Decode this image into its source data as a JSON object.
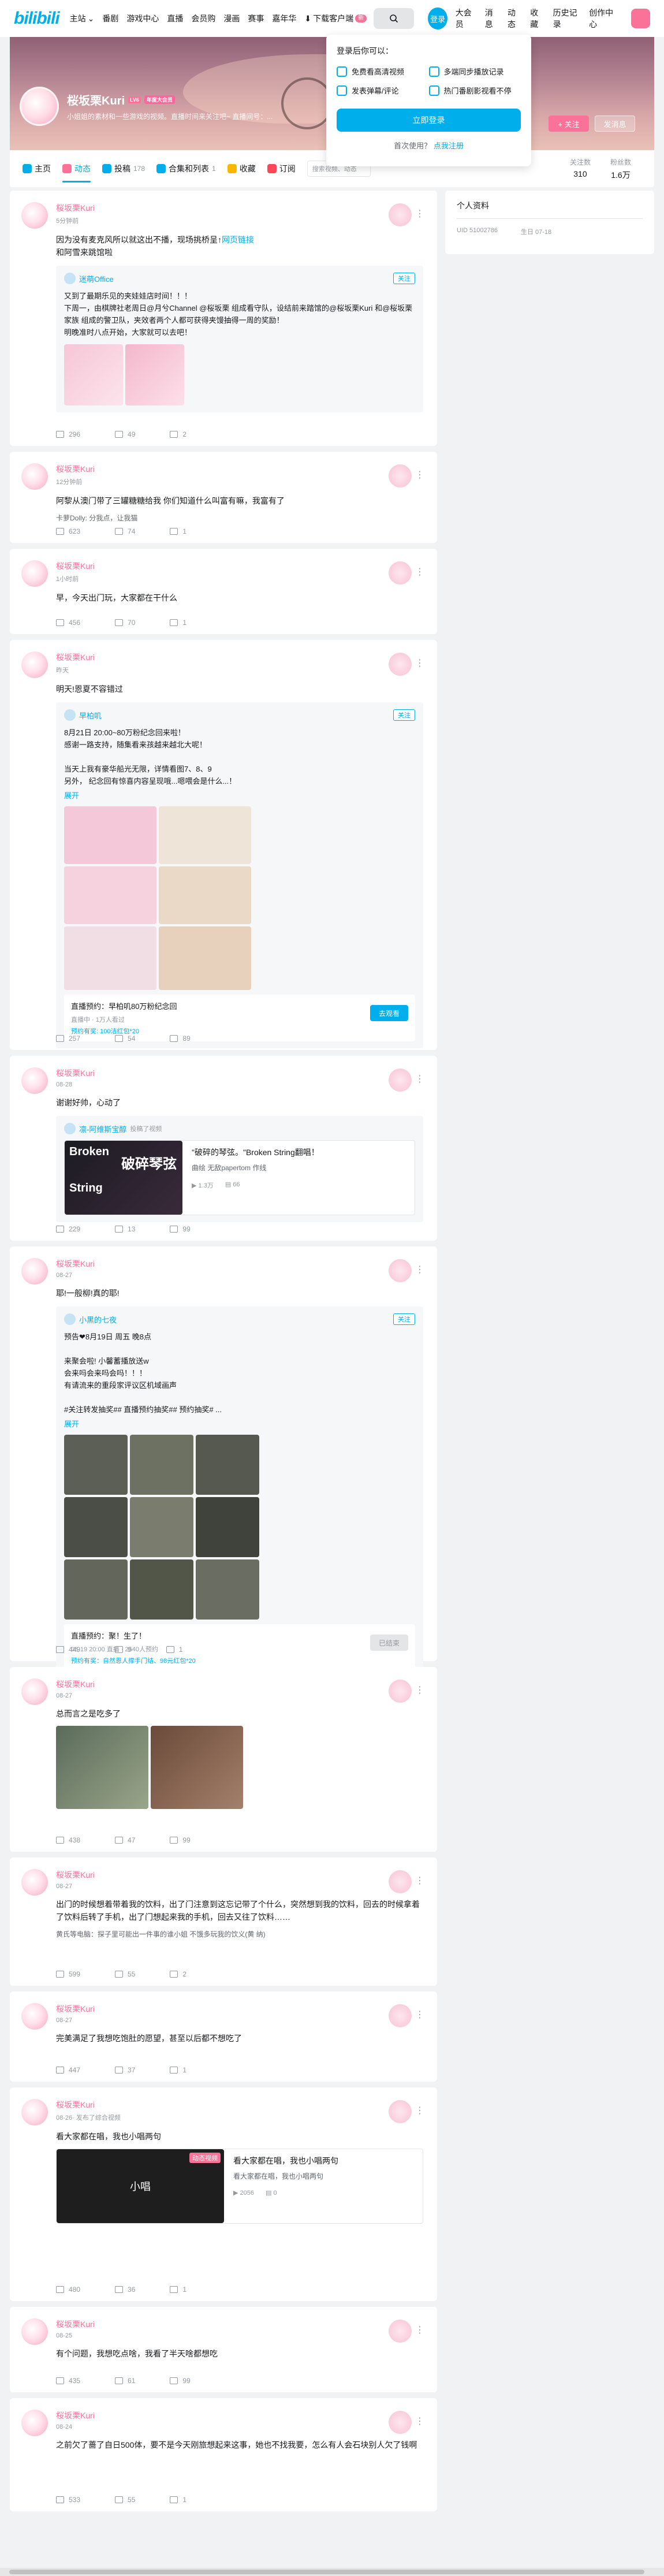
{
  "nav": {
    "logo": "bilibili",
    "left_items": [
      "主站",
      "番剧",
      "游戏中心",
      "直播",
      "会员购",
      "漫画",
      "赛事",
      "嘉年华",
      "下载客户端"
    ],
    "download_badge": "新",
    "login": "登录",
    "right_items": [
      "大会员",
      "消息",
      "动态",
      "收藏",
      "历史记录",
      "创作中心"
    ]
  },
  "profile": {
    "name": "桜坂栗Kuri",
    "level": "6",
    "vip": "年度大会员",
    "sign": "小姐姐的素材和一些游戏的视频。直播时间来关注吧~ 直播间号：...",
    "follow_button": "+ 关注",
    "message_button": "发消息"
  },
  "tabs": [
    {
      "label": "主页",
      "count": "",
      "icon_color": "#00aeec"
    },
    {
      "label": "动态",
      "count": "",
      "icon_color": "#fb7299"
    },
    {
      "label": "投稿",
      "count": "178",
      "icon_color": "#00aeec"
    },
    {
      "label": "合集和列表",
      "count": "1",
      "icon_color": "#00aeec"
    },
    {
      "label": "收藏",
      "count": "",
      "icon_color": "#fab600"
    },
    {
      "label": "订阅",
      "count": "",
      "icon_color": "#ff4757"
    }
  ],
  "tab_search_placeholder": "搜索视频、动态",
  "stats": [
    {
      "label": "关注数",
      "value": "310"
    },
    {
      "label": "粉丝数",
      "value": "1.6万"
    }
  ],
  "login_popup": {
    "title": "登录后你可以：",
    "benefits": [
      "免费看高清视频",
      "多端同步播放记录",
      "发表弹幕/评论",
      "热门番剧影视看不停"
    ],
    "button": "立即登录",
    "register_prefix": "首次使用？",
    "register_link": "点我注册"
  },
  "sidebar": {
    "title": "个人资料",
    "uid": "UID 51002786",
    "birthday": "生日 07-18"
  },
  "posts": [
    {
      "author": "桜坂栗Kuri",
      "time": "5分钟前",
      "text": "因为没有麦克风所以就这出不播，现场挑桥呈↑",
      "link": "网页链接",
      "text2": "和阿雪来跳馆啦",
      "sub_name": "迷萌Office",
      "sub_follow": "关注",
      "sub_text": "又到了最期乐见的夹娃娃店时间！！！\n下周一，由棋牌社老周日@月兮Channel @桜坂栗 组成看守队，设结前来踏馆的@桜坂栗Kuri 和@桜坂栗家族 组成的警卫队，夹效者两个人都可获得夹馒抽得一周的奖励！\n明晚准时八点开始，大家就可以去吧！",
      "likes": "2",
      "comments": "49",
      "forwards": "296"
    },
    {
      "author": "桜坂栗Kuri",
      "time": "12分钟前",
      "text": "阿黎从澳门带了三罐糖糖给我 你们知道什么叫富有嘛，我富有了",
      "peek": "卡萝Dolly: 分我点，让我猫",
      "likes": "1",
      "comments": "74",
      "forwards": "623"
    },
    {
      "author": "桜坂栗Kuri",
      "time": "1小时前",
      "text": "早，今天出门玩，大家都在干什么",
      "likes": "1",
      "comments": "70",
      "forwards": "456"
    },
    {
      "author": "桜坂栗Kuri",
      "time": "昨天",
      "text": "明天!恩夏不容错过",
      "sub_name": "早柏叽",
      "sub_follow": "关注",
      "sub_text": "8月21日 20:00~80万粉纪念回来啦！\n感谢一路支持，随集看来孩越来越北大呢！\n\n当天上我有豪华船光无限，详情看图7、8、9\n另外，  纪念回有惊喜内容呈现哦...嗯喂会是什么...！",
      "expand": "展开",
      "reserve_title": "直播预约：早柏叽80万粉纪念回",
      "reserve_meta": "直播中 · 1万人看过",
      "reserve_link": "预约有奖: 100洁红包*20 ",
      "reserve_btn": "去观看",
      "likes": "89",
      "comments": "54",
      "forwards": "257"
    },
    {
      "author": "桜坂栗Kuri",
      "time": "08-28",
      "text": "谢谢好帅，心动了",
      "sub_name": "凛-阿维斯宝醇",
      "sub_tag": "投稿了视频",
      "video_title": "\"破碎的琴弦。\"Broken String翻唱！",
      "video_desc": "曲绘 无敌papertom 作线",
      "video_views": "1.3万",
      "video_danmaku": "66",
      "thumb_text_1": "Broken",
      "thumb_text_2": "String",
      "thumb_text_3": "破碎琴弦",
      "likes": "99",
      "comments": "13",
      "forwards": "229"
    },
    {
      "author": "桜坂栗Kuri",
      "time": "08-27",
      "text": "耶!一般柳!真的耶!",
      "sub_name": "小黑的七夜",
      "sub_follow": "关注",
      "sub_text": "预告❤8月19日 周五 晚8点\n\n来聚会啦! 小馨蓄播放送w\n会来吗会来吗会吗！！！\n有请流来的重段家评议区机域画声\n\n#关注转发抽奖## 直播预约抽奖## 预约抽奖# ...",
      "expand": "展开",
      "reserve_title": "直播预约：聚！生了！",
      "reserve_meta": "08-19 20:00 直播 · 2540人预约",
      "reserve_link": "预约有奖：自然恩人撑手门结、98元红包*20",
      "reserve_btn": "已结束",
      "likes": "1",
      "comments": "9",
      "forwards": "449"
    },
    {
      "author": "桜坂栗Kuri",
      "time": "08-27",
      "text": "总而言之是吃多了",
      "likes": "99",
      "comments": "47",
      "forwards": "438"
    },
    {
      "author": "桜坂栗Kuri",
      "time": "08-27",
      "text": "出门的时候想着带着我的饮料，出了门注意到这忘记带了个什么，突然想到我的饮料，回去的时候拿着了饮料后转了手机，出了门想起来我的手机，回去又往了饮料……",
      "peek": "黄氏等电脑：探子里可能出一件事的谁小姐 不饿多玩我的饮义(黄 纳)",
      "likes": "2",
      "comments": "55",
      "forwards": "599"
    },
    {
      "author": "桜坂栗Kuri",
      "time": "08-27",
      "text": "完美满足了我想吃饱肚的愿望，甚至以后都不想吃了",
      "likes": "1",
      "comments": "37",
      "forwards": "447"
    },
    {
      "author": "桜坂栗Kuri",
      "time": "08-26",
      "tag": "· 发布了综合视频",
      "text": "看大家都在唱，我也小唱两句",
      "video_title": "看大家都在唱，我也小唱两句",
      "video_desc": "看大家都在唱，我也小唱两句",
      "video_views": "2056",
      "video_danmaku": "0",
      "thumb_text_1": "小唱",
      "thumb_text_2": "",
      "thumb_text_3": "",
      "thumb_badge": "动态视频",
      "likes": "1",
      "comments": "36",
      "forwards": "480"
    },
    {
      "author": "桜坂栗Kuri",
      "time": "08-25",
      "text": "有个问题，我想吃点啥，我看了半天啥都想吃",
      "likes": "99",
      "comments": "61",
      "forwards": "435"
    },
    {
      "author": "桜坂栗Kuri",
      "time": "08-24",
      "text": "之前欠了蔷了自日500体，要不是今天刚旅想起来这事，她也不找我要，怎么有人会石块别人欠了钱啊",
      "likes": "1",
      "comments": "55",
      "forwards": "533"
    }
  ]
}
